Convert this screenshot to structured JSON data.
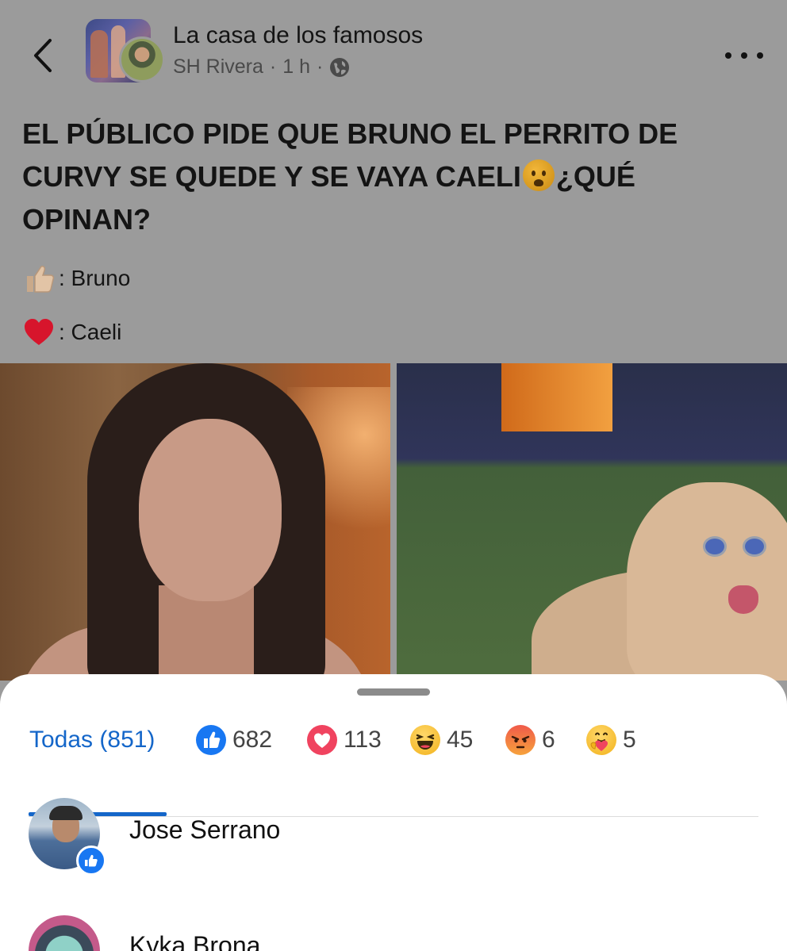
{
  "header": {
    "page_name": "La casa de los famosos",
    "author": "SH Rivera",
    "separator": "·",
    "time": "1 h",
    "back_icon": "chevron-left-icon",
    "more_icon": "more-dots-icon",
    "audience_icon": "globe-icon"
  },
  "post": {
    "text_part1": "EL PÚBLICO PIDE QUE BRUNO EL PERRITO DE CURVY SE QUEDE Y SE VAYA CAELI",
    "text_part2": "¿QUÉ OPINAN?",
    "inline_emoji": "frowning-face-icon",
    "options": [
      {
        "icon": "thumbs-up-icon",
        "label": ": Bruno"
      },
      {
        "icon": "red-heart-icon",
        "label": ": Caeli"
      }
    ],
    "images": [
      "crying-woman-photo",
      "dog-with-sunglasses-photo"
    ]
  },
  "reactions_sheet": {
    "tabs": [
      {
        "label": "Todas (851)",
        "selected": true
      },
      {
        "icon": "like-reaction-icon",
        "count": "682"
      },
      {
        "icon": "love-reaction-icon",
        "count": "113"
      },
      {
        "icon": "haha-reaction-icon",
        "count": "45"
      },
      {
        "icon": "angry-reaction-icon",
        "count": "6"
      },
      {
        "icon": "care-reaction-icon",
        "count": "5"
      }
    ],
    "people": [
      {
        "name": "Jose Serrano",
        "reaction": "like-reaction-icon"
      },
      {
        "name": "Kyka Brona"
      }
    ]
  },
  "colors": {
    "accent": "#1466c9",
    "like": "#1877f2",
    "love": "#f0435f",
    "dim_background": "#9b9b9b"
  }
}
